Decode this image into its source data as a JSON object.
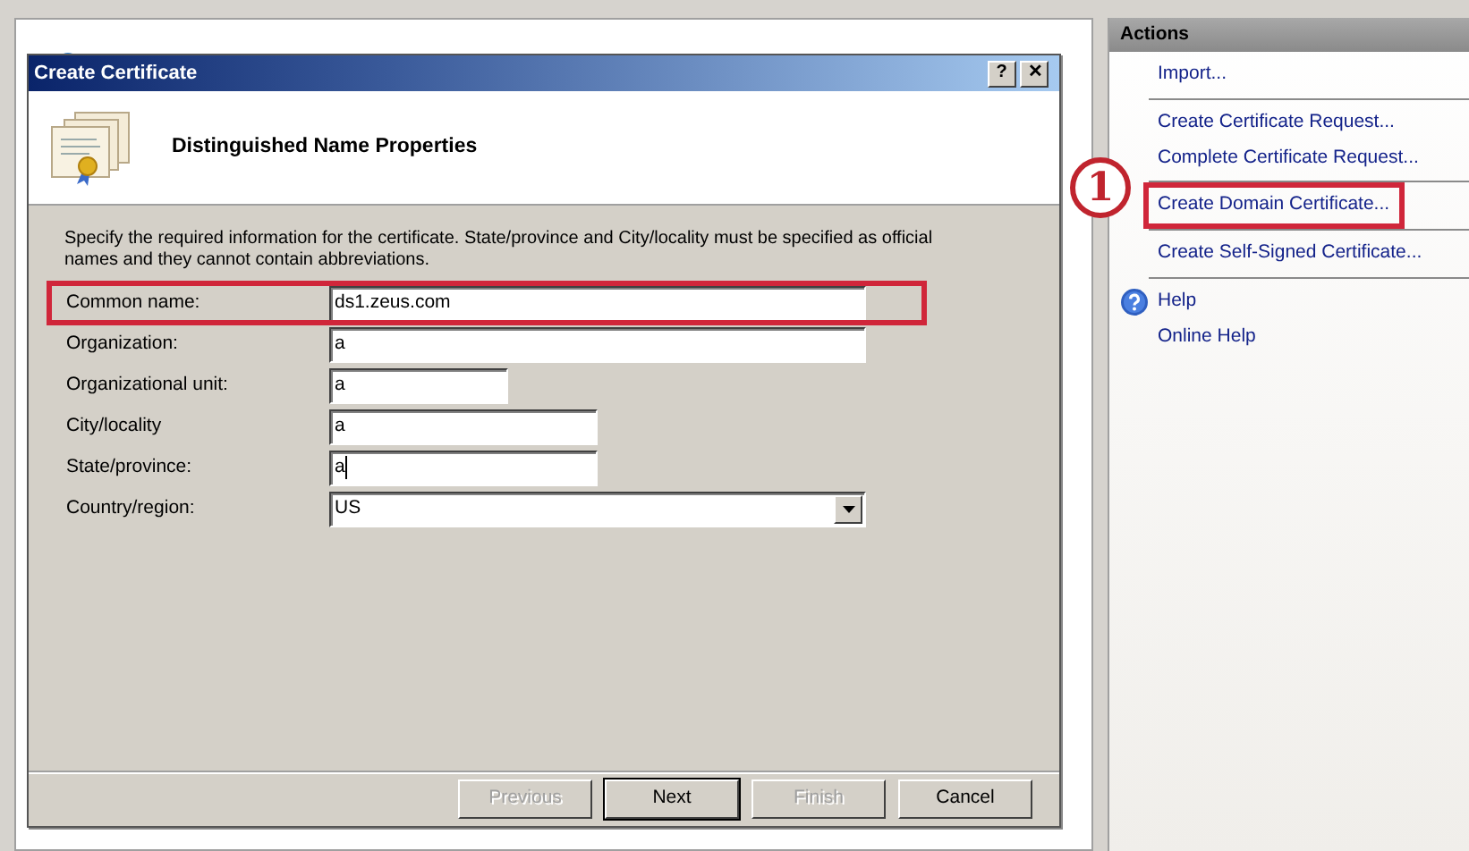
{
  "dialog": {
    "title": "Create Certificate",
    "help_button": "?",
    "close_button": "✕",
    "heading": "Distinguished Name Properties",
    "instructions": "Specify the required information for the certificate. State/province and City/locality must be specified as official names and they cannot contain abbreviations.",
    "fields": [
      {
        "label": "Common name:",
        "kind": "text",
        "value": "ds1.zeus.com",
        "highlighted": true,
        "focused": false
      },
      {
        "label": "Organization:",
        "kind": "text",
        "value": "a",
        "highlighted": false,
        "focused": false
      },
      {
        "label": "Organizational unit:",
        "kind": "text",
        "value": "a",
        "highlighted": false,
        "focused": false
      },
      {
        "label": "City/locality",
        "kind": "text",
        "value": "a",
        "highlighted": false,
        "focused": false
      },
      {
        "label": "State/province:",
        "kind": "text",
        "value": "a",
        "highlighted": false,
        "focused": true
      },
      {
        "label": "Country/region:",
        "kind": "select",
        "value": "US",
        "highlighted": false,
        "focused": false
      }
    ],
    "buttons": [
      {
        "label": "Previous",
        "disabled": true,
        "default": false
      },
      {
        "label": "Next",
        "disabled": false,
        "default": true
      },
      {
        "label": "Finish",
        "disabled": true,
        "default": false
      },
      {
        "label": "Cancel",
        "disabled": false,
        "default": false
      }
    ]
  },
  "actions": {
    "title": "Actions",
    "callout": "1",
    "groups": [
      [
        {
          "label": "Import...",
          "kind": "link",
          "highlighted": false
        }
      ],
      [
        {
          "label": "Create Certificate Request...",
          "kind": "link",
          "highlighted": false
        },
        {
          "label": "Complete Certificate Request...",
          "kind": "link",
          "highlighted": false
        }
      ],
      [
        {
          "label": "Create Domain Certificate...",
          "kind": "link",
          "highlighted": true
        }
      ],
      [
        {
          "label": "Create Self-Signed Certificate...",
          "kind": "link",
          "highlighted": false
        }
      ],
      [
        {
          "label": "Help",
          "kind": "help",
          "highlighted": false
        },
        {
          "label": "Online Help",
          "kind": "link",
          "highlighted": false
        }
      ]
    ]
  }
}
